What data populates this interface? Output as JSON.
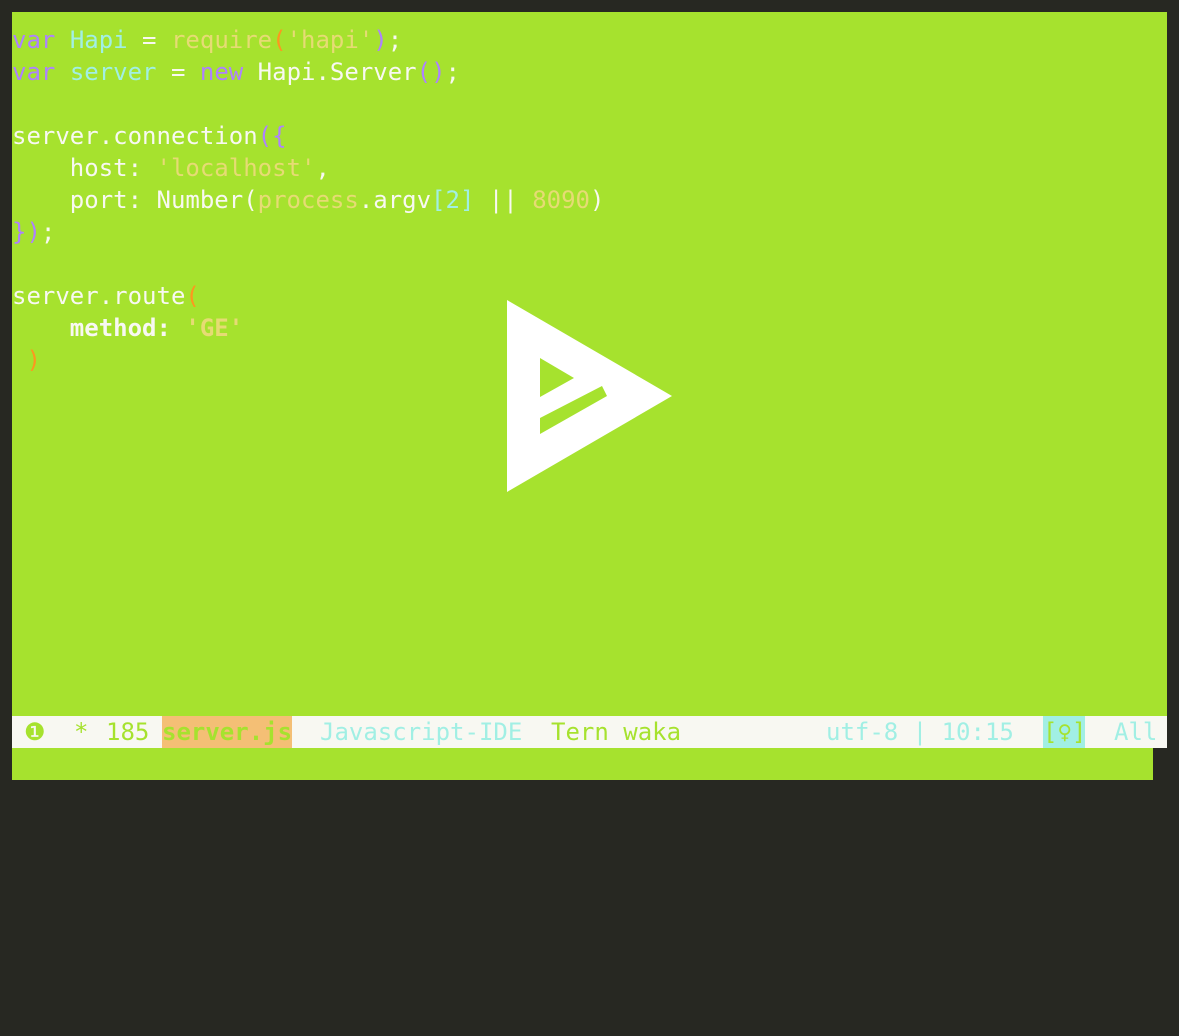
{
  "code": {
    "l1": {
      "kw": "var",
      "name": "Hapi",
      "eq": " = ",
      "call": "require",
      "open": "(",
      "arg": "'hapi'",
      "close": ")",
      "end": ";"
    },
    "l2": {
      "kw": "var",
      "name": "server",
      "eq": " = ",
      "new": "new",
      "cls": " Hapi.Server",
      "parens": "()",
      "end": ";"
    },
    "l4": {
      "obj": "server.connection",
      "open": "({"
    },
    "l5": {
      "key": "    host: ",
      "val": "'localhost'",
      "comma": ","
    },
    "l6": {
      "key": "    port: Number(",
      "proc": "process",
      "argv": ".argv",
      "idx": "[2]",
      "or": " || ",
      "num": "8090",
      "close": ")"
    },
    "l7": {
      "close": "})",
      "end": ";"
    },
    "l9": {
      "obj": "server.route",
      "open": "("
    },
    "l10": {
      "key": "method",
      "colon": ": ",
      "val": "'GE'"
    },
    "l11": {
      "close": ")"
    }
  },
  "modeline": {
    "indicator": "❶",
    "modified": "*",
    "line_count": "185",
    "filename": "server.js",
    "major_mode": "Javascript-IDE",
    "minor_modes": "Tern waka",
    "encoding_pos": "utf-8 | 10:15",
    "indicator2": "[♀]",
    "scroll": "All"
  },
  "colors": {
    "editor_bg": "#a6e22e",
    "frame_bg": "#272822",
    "modeline_bg": "#f8f8f2",
    "filename_bg": "#f4bf75"
  },
  "overlay": {
    "icon": "play-logo-icon"
  }
}
